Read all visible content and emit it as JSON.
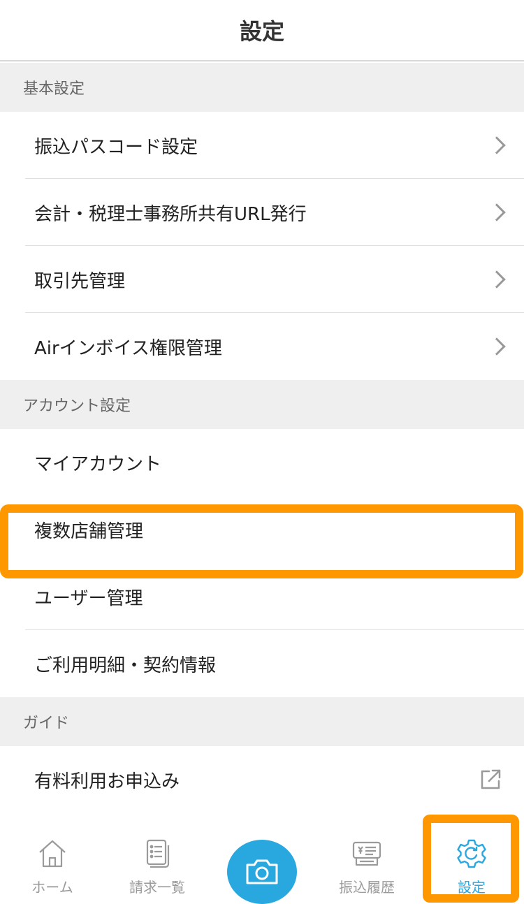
{
  "header": {
    "title": "設定"
  },
  "sections": {
    "basic": {
      "title": "基本設定",
      "items": [
        {
          "label": "振込パスコード設定"
        },
        {
          "label": "会計・税理士事務所共有URL発行"
        },
        {
          "label": "取引先管理"
        },
        {
          "label": "Airインボイス権限管理"
        }
      ]
    },
    "account": {
      "title": "アカウント設定",
      "items": [
        {
          "label": "マイアカウント"
        },
        {
          "label": "複数店舗管理"
        },
        {
          "label": "ユーザー管理"
        },
        {
          "label": "ご利用明細・契約情報"
        }
      ]
    },
    "guide": {
      "title": "ガイド",
      "items": [
        {
          "label": "有料利用お申込み"
        }
      ]
    }
  },
  "tabbar": {
    "home": {
      "label": "ホーム",
      "icon": "home-icon"
    },
    "invoices": {
      "label": "請求一覧",
      "icon": "document-list-icon"
    },
    "camera": {
      "icon": "camera-icon"
    },
    "transfers": {
      "label": "振込履歴",
      "icon": "transfer-history-icon"
    },
    "settings": {
      "label": "設定",
      "icon": "gear-icon",
      "active": true
    }
  },
  "colors": {
    "accent": "#29a8e0",
    "highlight": "#ff9800",
    "section_bg": "#efefef"
  }
}
